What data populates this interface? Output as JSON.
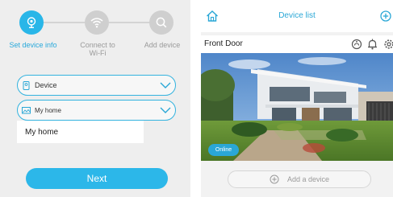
{
  "setup": {
    "steps": [
      {
        "label": "Set device info",
        "icon": "camera-pin-icon",
        "state": "active"
      },
      {
        "label": "Connect to Wi-Fi",
        "icon": "wifi-icon",
        "state": "inactive"
      },
      {
        "label": "Add device",
        "icon": "search-icon",
        "state": "inactive"
      }
    ],
    "device_field": {
      "value": "Device",
      "icon": "device-icon"
    },
    "location_field": {
      "value": "My home",
      "icon": "home-icon"
    },
    "dropdown_option": "My home",
    "next_label": "Next"
  },
  "device_list": {
    "title": "Device list",
    "device": {
      "name": "Front Door",
      "status": "Online"
    },
    "add_label": "Add a device"
  },
  "colors": {
    "accent": "#29b6e8",
    "inactive_step": "#cfcfcf",
    "panel_bg": "#eeeeee"
  }
}
